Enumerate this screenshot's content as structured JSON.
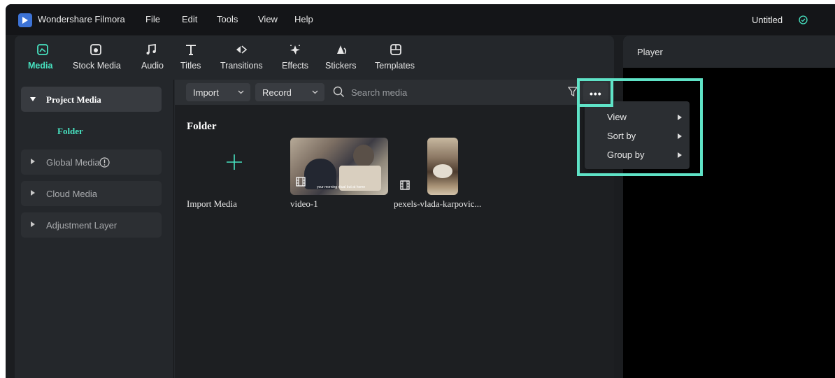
{
  "app": {
    "name": "Wondershare Filmora",
    "project_title": "Untitled"
  },
  "menu": [
    "File",
    "Edit",
    "Tools",
    "View",
    "Help"
  ],
  "tabs": [
    {
      "label": "Media",
      "icon": "media-icon",
      "active": true
    },
    {
      "label": "Stock Media",
      "icon": "stock-media-icon"
    },
    {
      "label": "Audio",
      "icon": "music-note-icon"
    },
    {
      "label": "Titles",
      "icon": "text-t-icon"
    },
    {
      "label": "Transitions",
      "icon": "transition-arrows-icon"
    },
    {
      "label": "Effects",
      "icon": "sparkle-star-icon"
    },
    {
      "label": "Stickers",
      "icon": "sticker-icon"
    },
    {
      "label": "Templates",
      "icon": "template-grid-icon"
    }
  ],
  "sidebar": {
    "items": [
      {
        "label": "Project Media",
        "expanded": true
      },
      {
        "label": "Global Media"
      },
      {
        "label": "Cloud Media"
      },
      {
        "label": "Adjustment Layer"
      }
    ],
    "subitem": "Folder"
  },
  "toolbar": {
    "import_label": "Import",
    "record_label": "Record",
    "search_placeholder": "Search media"
  },
  "content": {
    "folder_title": "Folder",
    "media": [
      {
        "label": "Import Media",
        "type": "import"
      },
      {
        "label": "video-1",
        "type": "video",
        "caption": "your morning ritual but at home"
      },
      {
        "label": "pexels-vlada-karpovic...",
        "type": "video"
      }
    ]
  },
  "dropdown": {
    "items": [
      {
        "label": "View"
      },
      {
        "label": "Sort by"
      },
      {
        "label": "Group by"
      }
    ]
  },
  "player": {
    "title": "Player"
  },
  "colors": {
    "accent": "#47e2c0",
    "highlight": "#5fe3c7",
    "brand": "#3d73d6"
  }
}
